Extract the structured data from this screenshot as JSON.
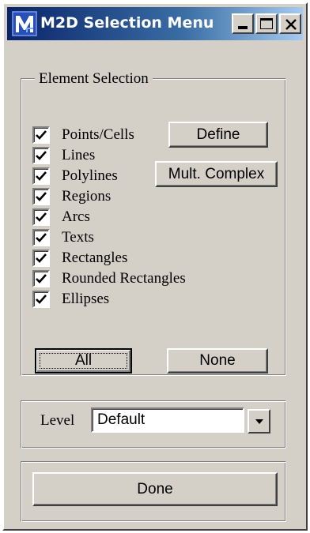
{
  "window": {
    "title": "M2D Selection Menu",
    "app_icon": "m2d-app-icon",
    "controls": {
      "minimize": "minimize-icon",
      "maximize": "maximize-icon",
      "close": "close-icon"
    }
  },
  "element_selection": {
    "legend": "Element Selection",
    "items": [
      {
        "label": "Points/Cells",
        "checked": true
      },
      {
        "label": "Lines",
        "checked": true
      },
      {
        "label": "Polylines",
        "checked": true
      },
      {
        "label": "Regions",
        "checked": true
      },
      {
        "label": "Arcs",
        "checked": true
      },
      {
        "label": "Texts",
        "checked": true
      },
      {
        "label": "Rectangles",
        "checked": true
      },
      {
        "label": "Rounded Rectangles",
        "checked": true
      },
      {
        "label": "Ellipses",
        "checked": true
      }
    ],
    "define_label": "Define",
    "mult_complex_label": "Mult. Complex",
    "all_label": "All",
    "none_label": "None"
  },
  "level": {
    "label": "Level",
    "value": "Default"
  },
  "done_label": "Done",
  "colors": {
    "face": "#d4d0c8",
    "titlebar_start": "#0a246a",
    "titlebar_end": "#a6caf0"
  }
}
